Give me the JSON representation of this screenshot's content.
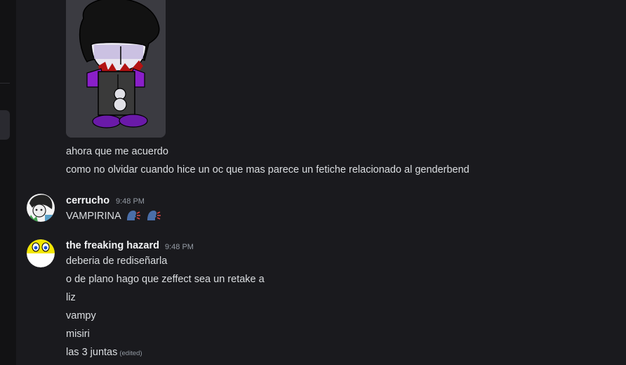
{
  "icons": {
    "sidebar": "server-rail",
    "attachment": "drawing-image",
    "emoji": "speaking-head-icon"
  },
  "messages_top": {
    "lines": [
      "ahora que me acuerdo",
      "como no olvidar cuando hice un oc que mas parece un fetiche relacionado al genderbend"
    ]
  },
  "cerrucho": {
    "username": "cerrucho",
    "time": "9:48 PM",
    "text": "VAMPIRINA"
  },
  "hazard": {
    "username": "the freaking hazard",
    "time": "9:48 PM",
    "lines": [
      "deberia de rediseñarla",
      "o de plano hago que zeffect sea un retake a",
      "liz",
      "vampy",
      "misiri",
      "las 3 juntas"
    ],
    "edited": "(edited)"
  }
}
